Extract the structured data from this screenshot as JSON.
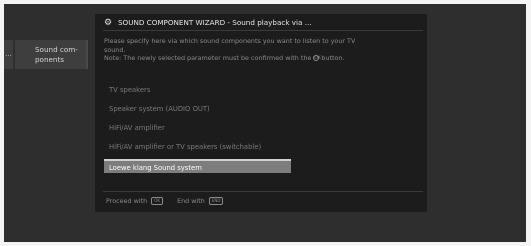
{
  "left_menu": {
    "strip_label": "...",
    "active_item": "Sound com-\nponents"
  },
  "dialog": {
    "icon": "gear-icon",
    "title": "SOUND COMPONENT WIZARD - Sound playback via ...",
    "instruction_line1": "Please specify here via which sound components you want to listen to your TV",
    "instruction_line2": "sound.",
    "instruction_line3a": "Note: The newly selected parameter must be confirmed with the",
    "ok_symbol": "OK",
    "instruction_line3b": "button.",
    "options": [
      "TV speakers",
      "Speaker system (AUDIO OUT)",
      "HiFi/AV amplifier",
      "HiFi/AV amplifier or TV speakers (switchable)",
      "Loewe klang Sound system"
    ],
    "selected_index": 4,
    "footer": {
      "proceed_label": "Proceed with",
      "proceed_key": "OK",
      "end_label": "End with",
      "end_key": "END"
    }
  }
}
